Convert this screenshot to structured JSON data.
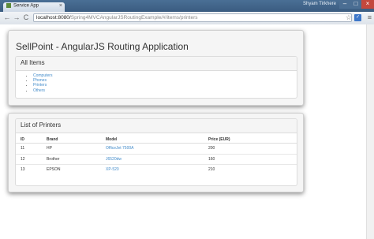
{
  "browser": {
    "tab_title": "Service App",
    "tab_close": "×",
    "user_label": "Shyam Tirkhere",
    "back": "←",
    "forward": "→",
    "reload": "C",
    "url_host": "localhost:8080/",
    "url_path": "Spring4MVCAngularJSRoutingExample/#/items/printers",
    "star": "☆",
    "menu": "≡",
    "window_buttons": {
      "minimize": "–",
      "maximize": "□",
      "close": "×"
    }
  },
  "page": {
    "title": "SellPoint - AngularJS Routing Application",
    "all_items": {
      "heading": "All Items",
      "items": [
        {
          "label": "Computers"
        },
        {
          "label": "Phones"
        },
        {
          "label": "Printers"
        },
        {
          "label": "Others"
        }
      ]
    },
    "printers": {
      "heading": "List of Printers",
      "columns": [
        "ID",
        "Brand",
        "Model",
        "Price (EUR)"
      ],
      "rows": [
        {
          "id": "11",
          "brand": "HP",
          "model": "OfficeJet 7500A",
          "price": "200"
        },
        {
          "id": "12",
          "brand": "Brother",
          "model": "J6520dw",
          "price": "160"
        },
        {
          "id": "13",
          "brand": "EPSON",
          "model": "XP-520",
          "price": "210"
        }
      ]
    }
  },
  "colors": {
    "link": "#428bca",
    "titlebar": "#3b5c80",
    "close_button": "#c4483d"
  }
}
